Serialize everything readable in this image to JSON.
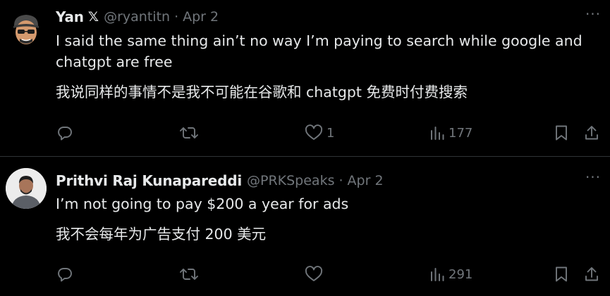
{
  "tweets": [
    {
      "author_name": "Yan",
      "badge": "𝕏",
      "handle": "@ryantitn",
      "separator": "·",
      "date": "Apr 2",
      "more": "···",
      "text_en": "I said the same thing ain’t no way I’m paying to search while google and chatgpt are free",
      "text_zh": "我说同样的事情不是我不可能在谷歌和 chatgpt 免费时付费搜索",
      "likes": "1",
      "views": "177",
      "avatar": "memoji-avatar"
    },
    {
      "author_name": "Prithvi Raj Kunapareddi",
      "handle": "@PRKSpeaks",
      "separator": "·",
      "date": "Apr 2",
      "more": "···",
      "text_en": "I’m not going to pay $200 a year for ads",
      "text_zh": "我不会每年为广告支付 200 美元",
      "views": "291",
      "avatar": "profile-photo-avatar"
    }
  ],
  "icons": {
    "reply": "reply-icon",
    "repost": "repost-icon",
    "like": "heart-icon",
    "views": "views-chart-icon",
    "bookmark": "bookmark-icon",
    "share": "share-icon"
  },
  "colors": {
    "background": "#000000",
    "text_primary": "#e7e9ea",
    "text_secondary": "#71767b",
    "divider": "#2f3336"
  }
}
